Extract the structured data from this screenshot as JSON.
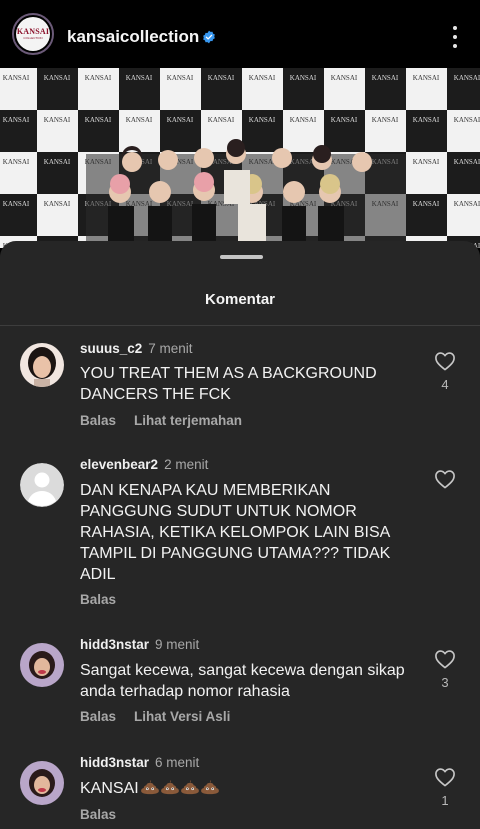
{
  "header": {
    "username": "kansaicollection",
    "logo_text": "KANSAI",
    "logo_sub": "COLLECTION"
  },
  "post": {
    "backdrop_text": "KANSAI"
  },
  "sheet": {
    "title": "Komentar"
  },
  "colors": {
    "background": "#000000",
    "sheet": "#262626",
    "verified": "#3797f0",
    "secondary_text": "#a8a8a8"
  },
  "comments": [
    {
      "username": "suuus_c2",
      "time": "7 menit",
      "text": "YOU TREAT THEM AS A BACKGROUND DANCERS THE FCK",
      "actions": [
        "Balas",
        "Lihat terjemahan"
      ],
      "likes": "4",
      "avatar": "photo-avatar"
    },
    {
      "username": "elevenbear2",
      "time": "2 menit",
      "text": "DAN KENAPA KAU MEMBERIKAN PANGGUNG SUDUT UNTUK NOMOR RAHASIA, KETIKA KELOMPOK LAIN BISA TAMPIL DI PANGGUNG UTAMA??? TIDAK ADIL",
      "actions": [
        "Balas"
      ],
      "likes": "",
      "avatar": "default-avatar"
    },
    {
      "username": "hidd3nstar",
      "time": "9 menit",
      "text": "Sangat kecewa, sangat kecewa dengan sikap anda terhadap nomor rahasia",
      "actions": [
        "Balas",
        "Lihat Versi Asli"
      ],
      "likes": "3",
      "avatar": "photo-avatar"
    },
    {
      "username": "hidd3nstar",
      "time": "6 menit",
      "text": "KANSAI",
      "emoji": "pile-of-poo-icon x4",
      "actions": [
        "Balas"
      ],
      "likes": "1",
      "avatar": "photo-avatar"
    }
  ]
}
